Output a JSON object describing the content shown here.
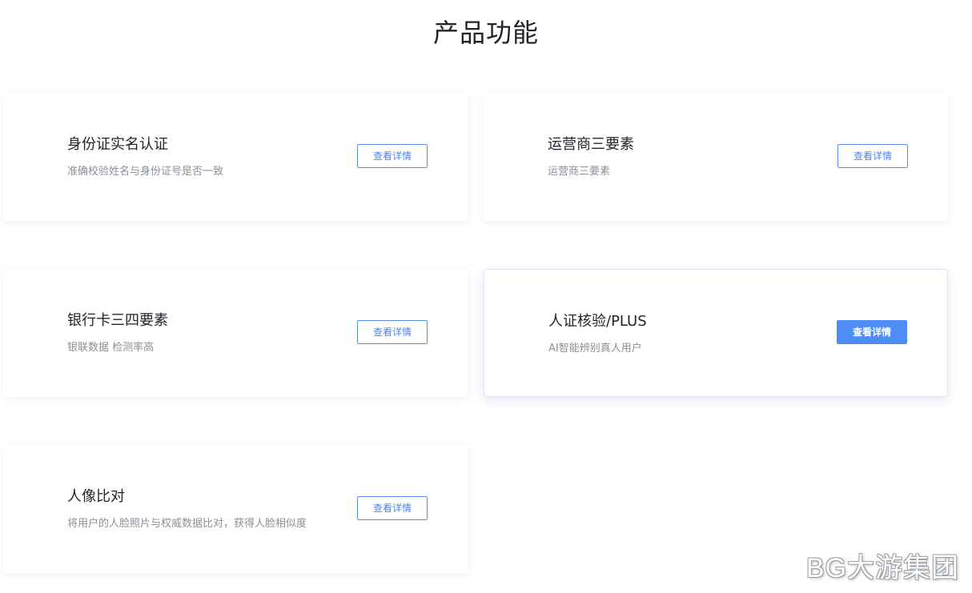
{
  "page": {
    "title": "产品功能"
  },
  "cards": [
    {
      "title": "身份证实名认证",
      "desc": "准确校验姓名与身份证号是否一致",
      "button": "查看详情"
    },
    {
      "title": "运营商三要素",
      "desc": "运营商三要素",
      "button": "查看详情"
    },
    {
      "title": "银行卡三四要素",
      "desc": "银联数据 检测率高",
      "button": "查看详情"
    },
    {
      "title": "人证核验/PLUS",
      "desc": "AI智能辨别真人用户",
      "button": "查看详情",
      "active": true
    },
    {
      "title": "人像比对",
      "desc": "将用户的人脸照片与权威数据比对，获得人脸相似度",
      "button": "查看详情"
    }
  ],
  "watermark": {
    "text": "BG大游集团"
  },
  "colors": {
    "accent": "#4e8df5",
    "title": "#1f2329",
    "desc": "#8a8f99"
  }
}
